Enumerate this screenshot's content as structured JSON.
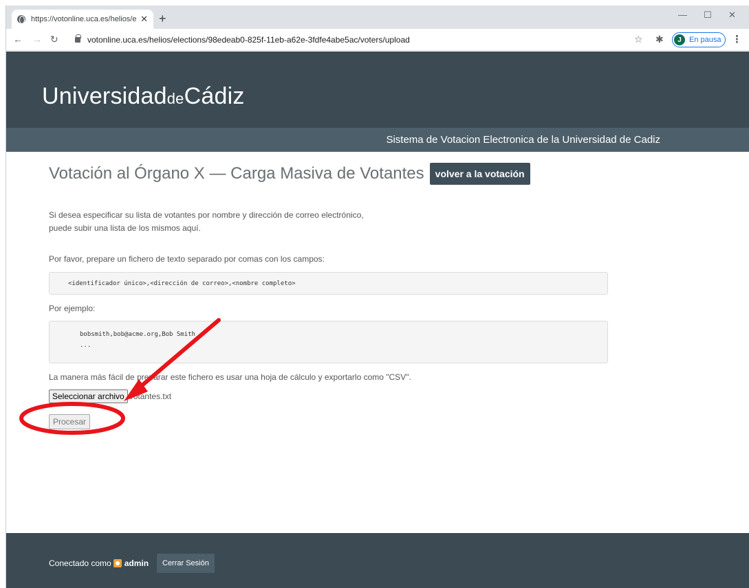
{
  "browser": {
    "tab_title": "https://votonline.uca.es/helios/el",
    "new_tab_icon": "plus-icon",
    "url": "votonline.uca.es/helios/elections/98edeab0-825f-11eb-a62e-3fdfe4abe5ac/voters/upload",
    "profile_initial": "J",
    "profile_status": "En pausa"
  },
  "header": {
    "logo_part1": "Universidad",
    "logo_part2": "de",
    "logo_part3": "Cádiz",
    "subtitle": "Sistema de Votacion Electronica de la Universidad de Cadiz"
  },
  "main": {
    "title": "Votación al Órgano X — Carga Masiva de Votantes",
    "back_button": "volver a la votación",
    "intro_line1": "Si desea especificar su lista de votantes por nombre y dirección de correo electrónico,",
    "intro_line2": "puede subir una lista de los mismos aquí.",
    "instructions": "Por favor, prepare un fichero de texto separado por comas con los campos:",
    "fields_format": "<identificador único>,<dirección de correo>,<nombre completo>",
    "example_label": "Por ejemplo:",
    "example_line1": "bobsmith,bob@acme.org,Bob Smith",
    "example_line2": "...",
    "csv_hint": "La manera más fácil de preparar este fichero es usar una hoja de cálculo y exportarlo como \"CSV\".",
    "file_button": "Seleccionar archivo",
    "file_name": "votantes.txt",
    "submit_button": "Procesar"
  },
  "footer": {
    "connected_as": "Conectado como",
    "username": "admin",
    "logout_button": "Cerrar Sesión"
  },
  "colors": {
    "header_bg": "#3b4a53",
    "subheader_bg": "#4d5f6a",
    "annotation_red": "#e8151b"
  }
}
